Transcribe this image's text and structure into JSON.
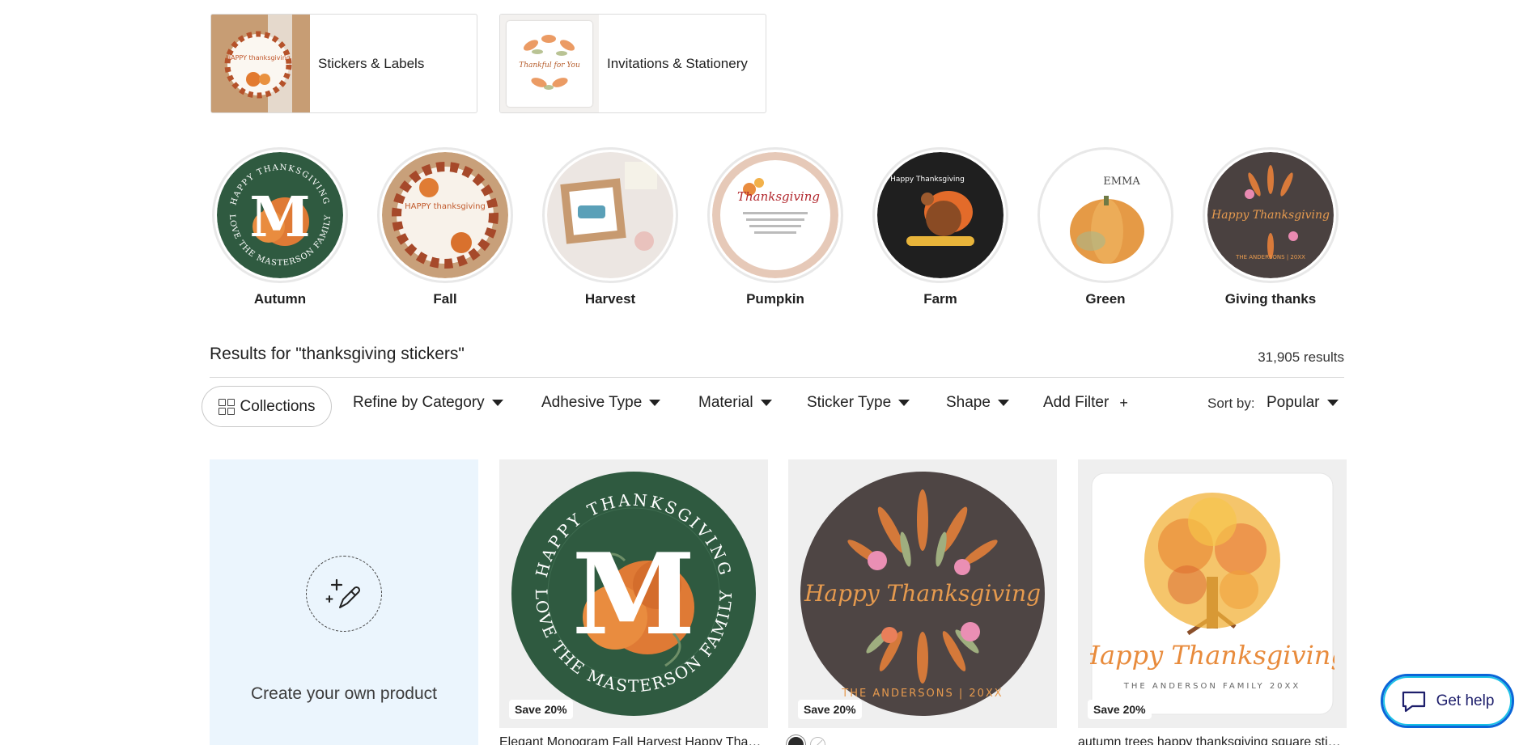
{
  "categories": [
    {
      "label": "Stickers & Labels",
      "thumb_text": "HAPPY thanksgiving"
    },
    {
      "label": "Invitations & Stationery",
      "thumb_text": "Thankful for You"
    }
  ],
  "styles": [
    {
      "label": "Autumn",
      "ring_top": "HAPPY THANKSGIVING",
      "ring_bottom": "LOVE THE MASTERSON FAMILY",
      "letter": "M"
    },
    {
      "label": "Fall",
      "art_text": "HAPPY thanksgiving"
    },
    {
      "label": "Harvest"
    },
    {
      "label": "Pumpkin",
      "art_text": "Thanksgiving"
    },
    {
      "label": "Farm",
      "art_text": "Happy Thanksgiving"
    },
    {
      "label": "Green",
      "art_text": "EMMA"
    },
    {
      "label": "Giving thanks",
      "art_text": "Happy Thanksgiving",
      "art_sub": "THE ANDERSONS | 20XX"
    }
  ],
  "results": {
    "title": "Results for \"thanksgiving stickers\"",
    "count": "31,905 results"
  },
  "filters": {
    "collections": "Collections",
    "items": [
      "Refine by Category",
      "Adhesive Type",
      "Material",
      "Sticker Type",
      "Shape"
    ],
    "add_filter": "Add Filter",
    "sort_label": "Sort by:",
    "sort_value": "Popular"
  },
  "create": {
    "label": "Create your own product"
  },
  "products": [
    {
      "badge": "Save 20%",
      "title": "Elegant Monogram Fall Harvest Happy Thanksgiving",
      "ring_top": "HAPPY THANKSGIVING",
      "ring_bottom": "LOVE THE MASTERSON FAMILY",
      "letter": "M"
    },
    {
      "badge": "Save 20%",
      "title": "",
      "script": "Happy Thanksgiving",
      "sub": "THE ANDERSONS | 20XX",
      "swatches": [
        "#2b2b2b",
        "#ffffff"
      ]
    },
    {
      "badge": "Save 20%",
      "title": "autumn trees happy thanksgiving square stickers",
      "script": "Happy Thanksgiving",
      "sub": "THE ANDERSON FAMILY 20XX"
    }
  ],
  "help": {
    "label": "Get help"
  },
  "colors": {
    "green": "#2f5a40",
    "brown": "#4e4544",
    "orange": "#e07b39",
    "accent_blue": "#0b65d8"
  }
}
